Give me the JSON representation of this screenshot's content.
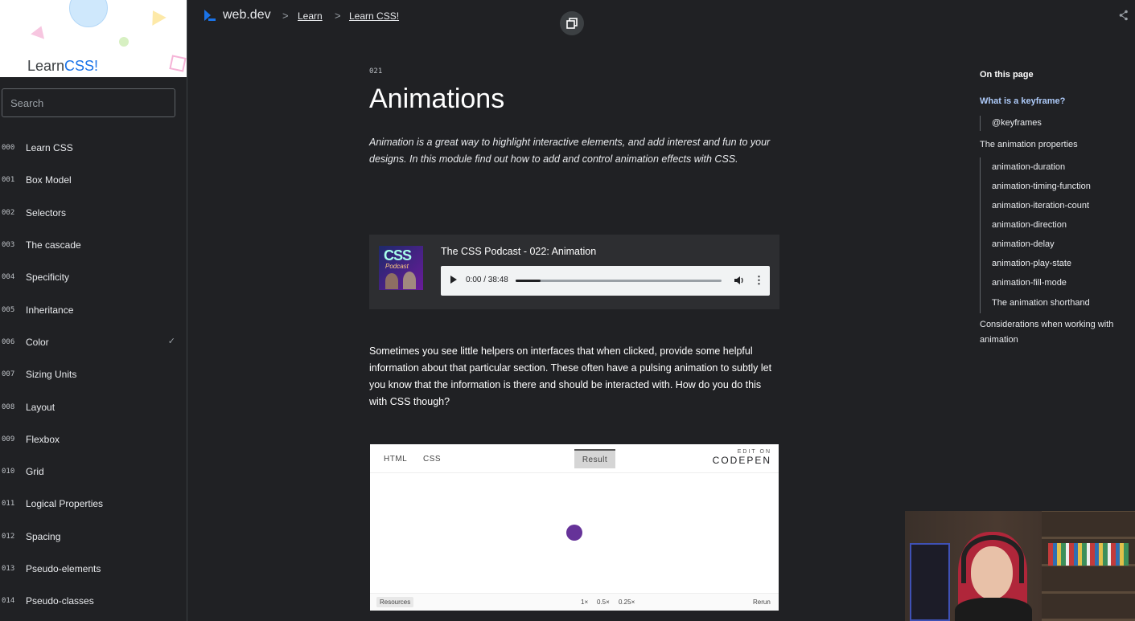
{
  "sidebar": {
    "hero_title_prefix": "Learn",
    "hero_title_accent": "CSS!",
    "search_placeholder": "Search",
    "items": [
      {
        "num": "000",
        "label": "Learn CSS"
      },
      {
        "num": "001",
        "label": "Box Model"
      },
      {
        "num": "002",
        "label": "Selectors"
      },
      {
        "num": "003",
        "label": "The cascade"
      },
      {
        "num": "004",
        "label": "Specificity"
      },
      {
        "num": "005",
        "label": "Inheritance"
      },
      {
        "num": "006",
        "label": "Color",
        "check": "✓"
      },
      {
        "num": "007",
        "label": "Sizing Units"
      },
      {
        "num": "008",
        "label": "Layout"
      },
      {
        "num": "009",
        "label": "Flexbox"
      },
      {
        "num": "010",
        "label": "Grid"
      },
      {
        "num": "011",
        "label": "Logical Properties"
      },
      {
        "num": "012",
        "label": "Spacing"
      },
      {
        "num": "013",
        "label": "Pseudo-elements"
      },
      {
        "num": "014",
        "label": "Pseudo-classes"
      }
    ]
  },
  "topbar": {
    "logo_text": "web.dev",
    "crumb_sep": ">",
    "breadcrumbs": [
      "Learn",
      "Learn CSS!"
    ]
  },
  "main": {
    "module_number": "021",
    "title": "Animations",
    "lede": "Animation is a great way to highlight interactive elements, and add interest and fun to your designs. In this module find out how to add and control animation effects with CSS.",
    "podcast": {
      "cover_text": "CSS",
      "cover_subtext": "Podcast",
      "title": "The CSS Podcast - 022: Animation",
      "time": "0:00 / 38:48",
      "progress": 0.12,
      "more": "⋮"
    },
    "paragraph": "Sometimes you see little helpers on interfaces that when clicked, provide some helpful information about that particular section. These often have a pulsing animation to subtly let you know that the information is there and should be interacted with. How do you do this with CSS though?",
    "codepen": {
      "tabs": [
        "HTML",
        "CSS"
      ],
      "result_tab": "Result",
      "edit_on": "EDIT ON",
      "brand": "CODEPEN",
      "dot_color": "#663399",
      "resources": "Resources",
      "zooms": [
        "1×",
        "0.5×",
        "0.25×"
      ],
      "rerun": "Rerun"
    }
  },
  "toc": {
    "heading": "On this page",
    "items": [
      {
        "label": "What is a keyframe?",
        "level": 1,
        "active": true
      },
      {
        "label": "@keyframes",
        "level": 2
      },
      {
        "label": "The animation properties",
        "level": 1
      },
      {
        "label": "animation-duration",
        "level": 2
      },
      {
        "label": "animation-timing-function",
        "level": 2
      },
      {
        "label": "animation-iteration-count",
        "level": 2
      },
      {
        "label": "animation-direction",
        "level": 2
      },
      {
        "label": "animation-delay",
        "level": 2
      },
      {
        "label": "animation-play-state",
        "level": 2
      },
      {
        "label": "animation-fill-mode",
        "level": 2
      },
      {
        "label": "The animation shorthand",
        "level": 2
      },
      {
        "label": "Considerations when working with animation",
        "level": 1
      }
    ]
  },
  "colors": {
    "background": "#202124",
    "accent": "#1a73e8",
    "toc_active": "#aecbfa"
  }
}
